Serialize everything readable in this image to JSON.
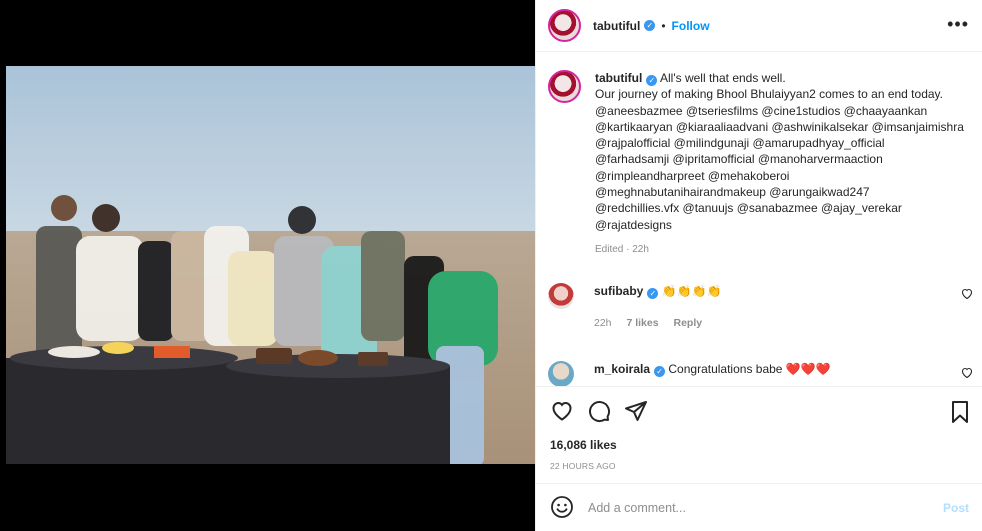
{
  "post": {
    "username": "tabutiful",
    "dot": "•",
    "follow_label": "Follow",
    "more_label": "•••",
    "verified_icon": "✓"
  },
  "caption": {
    "username": "tabutiful",
    "lines": [
      "All's well that ends well.",
      "Our journey of making Bhool Bhulaiyyan2 comes to an end today.",
      "@aneesbazmee @tseriesfilms @cine1studios @chaayaankan",
      "@kartikaaryan @kiaraaliaadvani @ashwinikalsekar @imsanjaimishra",
      "@rajpalofficial @milindgunaji @amarupadhyay_official",
      "@farhadsamji @ipritamofficial @manoharvermaaction",
      "@rimpleandharpreet @mehakoberoi",
      "@meghnabutanihairandmakeup @arungaikwad247",
      "@redchillies.vfx @tanuujs @sanabazmee @ajay_verekar",
      "@rajatdesigns"
    ],
    "edited": "Edited · 22h"
  },
  "comments": [
    {
      "username": "sufibaby",
      "text": "👏👏👏👏",
      "time": "22h",
      "likes": "7 likes",
      "reply": "Reply"
    },
    {
      "username": "m_koirala",
      "text": "Congratulations babe ❤️❤️❤️"
    }
  ],
  "actions": {
    "likes": "16,086 likes",
    "ago": "22 HOURS AGO",
    "add_comment_placeholder": "Add a comment...",
    "post_label": "Post"
  },
  "colors": {
    "link": "#0095f6",
    "muted": "#8e8e8e",
    "post_disabled": "#b2dffc"
  },
  "icons": {
    "like": "heart-icon",
    "comment": "comment-icon",
    "share": "share-icon",
    "save": "bookmark-icon",
    "emoji": "emoji-icon",
    "more": "more-options-icon"
  }
}
